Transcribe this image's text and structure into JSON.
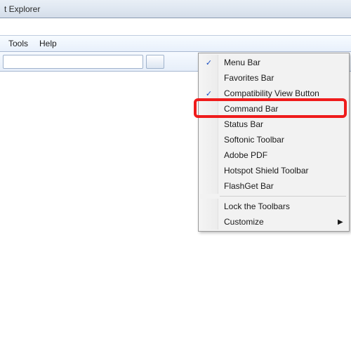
{
  "window": {
    "title_fragment": "t Explorer"
  },
  "menubar": {
    "items": [
      {
        "label": "Tools"
      },
      {
        "label": "Help"
      }
    ]
  },
  "context_menu": {
    "groups": [
      [
        {
          "label": "Menu Bar",
          "checked": true,
          "submenu": false
        },
        {
          "label": "Favorites Bar",
          "checked": false,
          "submenu": false
        },
        {
          "label": "Compatibility View Button",
          "checked": true,
          "submenu": false
        },
        {
          "label": "Command Bar",
          "checked": false,
          "submenu": false,
          "highlighted": true
        },
        {
          "label": "Status Bar",
          "checked": false,
          "submenu": false
        },
        {
          "label": "Softonic Toolbar",
          "checked": false,
          "submenu": false
        },
        {
          "label": "Adobe PDF",
          "checked": false,
          "submenu": false
        },
        {
          "label": "Hotspot Shield Toolbar",
          "checked": false,
          "submenu": false
        },
        {
          "label": "FlashGet Bar",
          "checked": false,
          "submenu": false
        }
      ],
      [
        {
          "label": "Lock the Toolbars",
          "checked": false,
          "submenu": false
        },
        {
          "label": "Customize",
          "checked": false,
          "submenu": true
        }
      ]
    ]
  }
}
